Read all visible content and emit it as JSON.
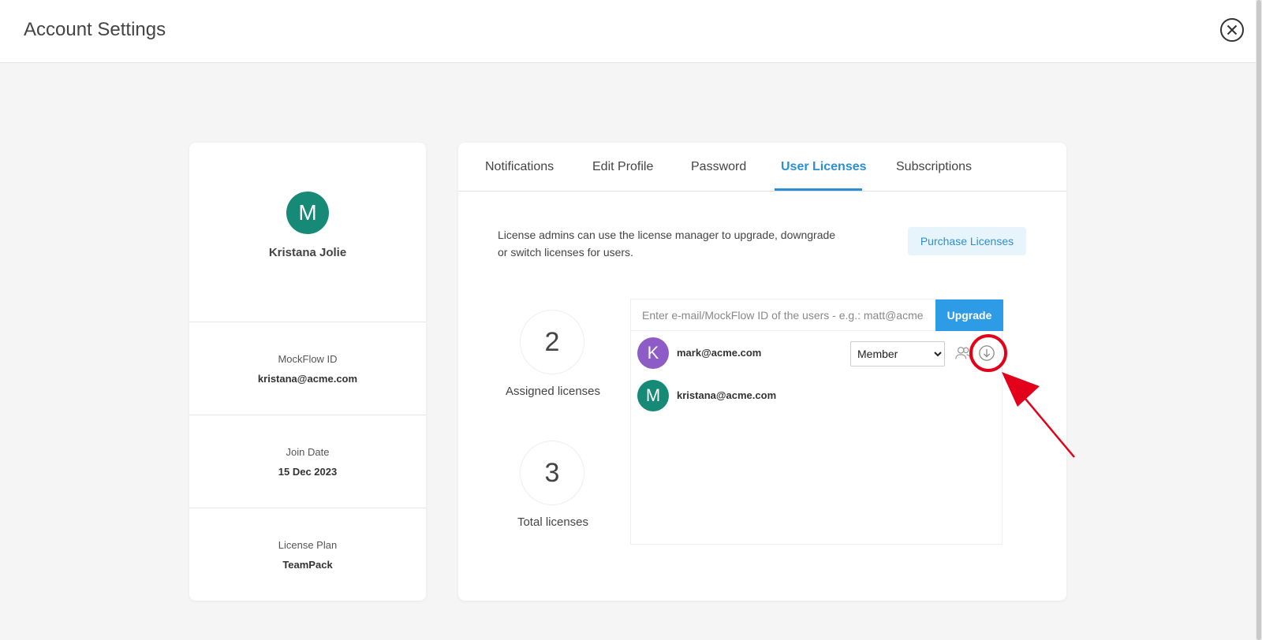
{
  "header": {
    "title": "Account Settings"
  },
  "profile": {
    "avatar_letter": "M",
    "avatar_color": "#178a77",
    "name": "Kristana Jolie",
    "mockflow_id_label": "MockFlow ID",
    "mockflow_id": "kristana@acme.com",
    "join_date_label": "Join Date",
    "join_date": "15 Dec 2023",
    "license_plan_label": "License Plan",
    "license_plan": "TeamPack"
  },
  "tabs": [
    {
      "label": "Notifications"
    },
    {
      "label": "Edit Profile"
    },
    {
      "label": "Password"
    },
    {
      "label": "User Licenses"
    },
    {
      "label": "Subscriptions"
    }
  ],
  "licenses": {
    "description": "License admins can use the license manager to upgrade, downgrade or switch licenses for users.",
    "purchase_label": "Purchase Licenses",
    "assigned_count": "2",
    "assigned_label": "Assigned licenses",
    "total_count": "3",
    "total_label": "Total licenses",
    "input_placeholder": "Enter e-mail/MockFlow ID of the users - e.g.: matt@acme.com",
    "upgrade_label": "Upgrade",
    "users": [
      {
        "avatar_letter": "K",
        "avatar_color": "#8e5cc7",
        "email": "mark@acme.com",
        "role": "Member"
      },
      {
        "avatar_letter": "M",
        "avatar_color": "#178a77",
        "email": "kristana@acme.com"
      }
    ],
    "role_options": [
      "Member"
    ]
  },
  "colors": {
    "accent": "#2b8fd1",
    "annotation": "#e3001b"
  }
}
